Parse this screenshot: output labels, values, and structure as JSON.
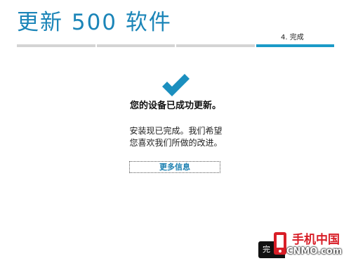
{
  "header": {
    "title": "更新 500 软件",
    "step_label": "4. 完成",
    "progress": {
      "total_steps": 4,
      "active_step": 4
    }
  },
  "main": {
    "check_icon": "checkmark-icon",
    "headline": "您的设备已成功更新。",
    "message": "安装现已完成。我们希望您喜欢我们所做的改进。",
    "more_info_label": "更多信息"
  },
  "footer": {
    "done_label": "完",
    "watermark_cn": "手机中国",
    "watermark_en": "CNMO.com"
  },
  "colors": {
    "accent": "#1b85b8",
    "progress_active": "#1b9ac7",
    "progress_inactive": "#d4d4d4",
    "watermark_red": "#d81e27"
  }
}
